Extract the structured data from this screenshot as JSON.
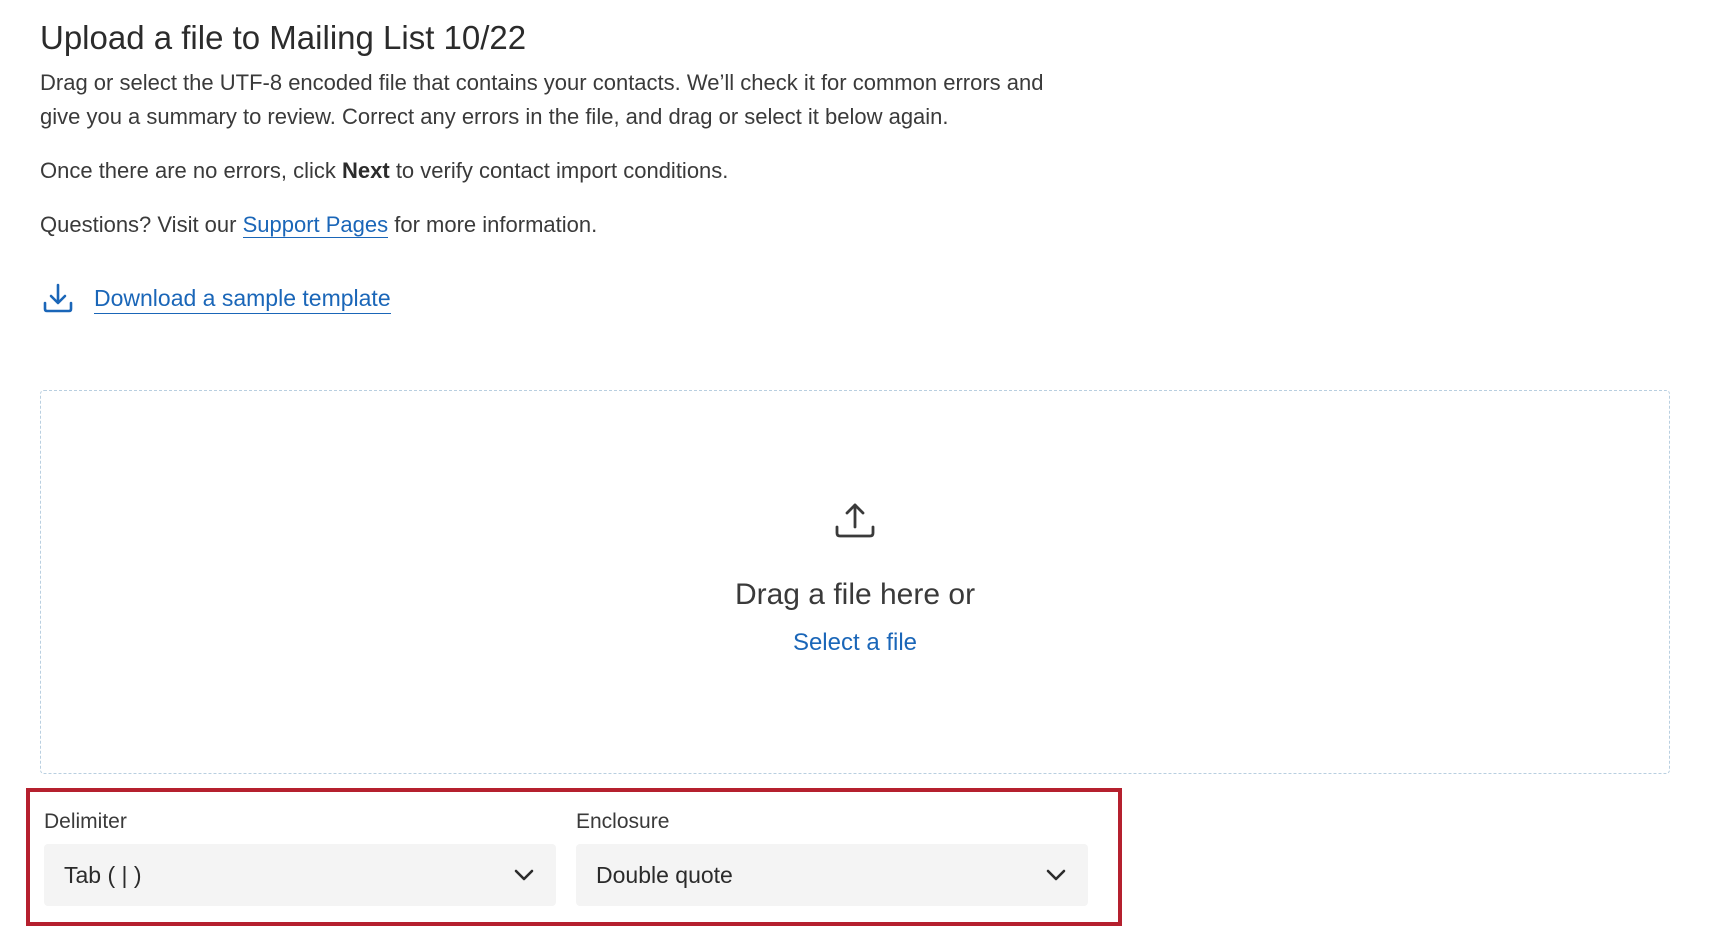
{
  "header": {
    "title": "Upload a file to Mailing List 10/22"
  },
  "intro": {
    "description": "Drag or select the UTF-8 encoded file that contains your contacts. We’ll check it for common errors and give you a summary to review. Correct any errors in the file, and drag or select it below again.",
    "next_prefix": "Once there are no errors, click ",
    "next_bold": "Next",
    "next_suffix": " to verify contact import conditions.",
    "questions_prefix": "Questions? Visit our ",
    "support_link": "Support Pages",
    "questions_suffix": " for more information."
  },
  "download": {
    "icon": "download-icon",
    "label": "Download a sample template"
  },
  "dropzone": {
    "icon": "upload-icon",
    "text": "Drag a file here or",
    "select_label": "Select a file"
  },
  "options": {
    "delimiter": {
      "label": "Delimiter",
      "value": "Tab ( | )"
    },
    "enclosure": {
      "label": "Enclosure",
      "value": "Double quote"
    }
  },
  "colors": {
    "link": "#1a66b8",
    "highlight_border": "#b5202e",
    "dropzone_border": "#b9cfe0",
    "select_bg": "#f4f4f4"
  }
}
